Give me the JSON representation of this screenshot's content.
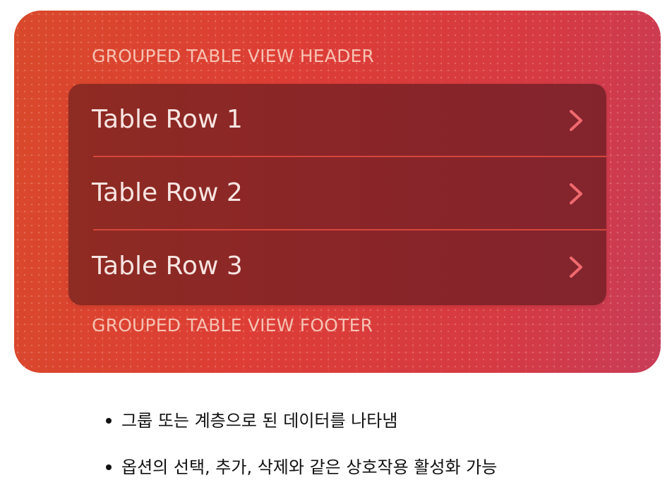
{
  "colors": {
    "card_gradient_start": "#d9492b",
    "card_gradient_end": "#c83c58",
    "table_background": "#8a2528",
    "header_footer_text": "#f6c2b3",
    "row_text": "#f7e4e1",
    "chevron": "#f06a6f",
    "separator": "#d5453c"
  },
  "table": {
    "header": "GROUPED TABLE VIEW HEADER",
    "footer": "GROUPED TABLE VIEW FOOTER",
    "rows": [
      {
        "label": "Table Row 1",
        "accessory_icon": "chevron-right-icon"
      },
      {
        "label": "Table Row 2",
        "accessory_icon": "chevron-right-icon"
      },
      {
        "label": "Table Row 3",
        "accessory_icon": "chevron-right-icon"
      }
    ]
  },
  "notes": {
    "items": [
      "그룹 또는 계층으로 된 데이터를 나타냄",
      "옵션의 선택, 추가, 삭제와 같은 상호작용 활성화 가능"
    ]
  }
}
